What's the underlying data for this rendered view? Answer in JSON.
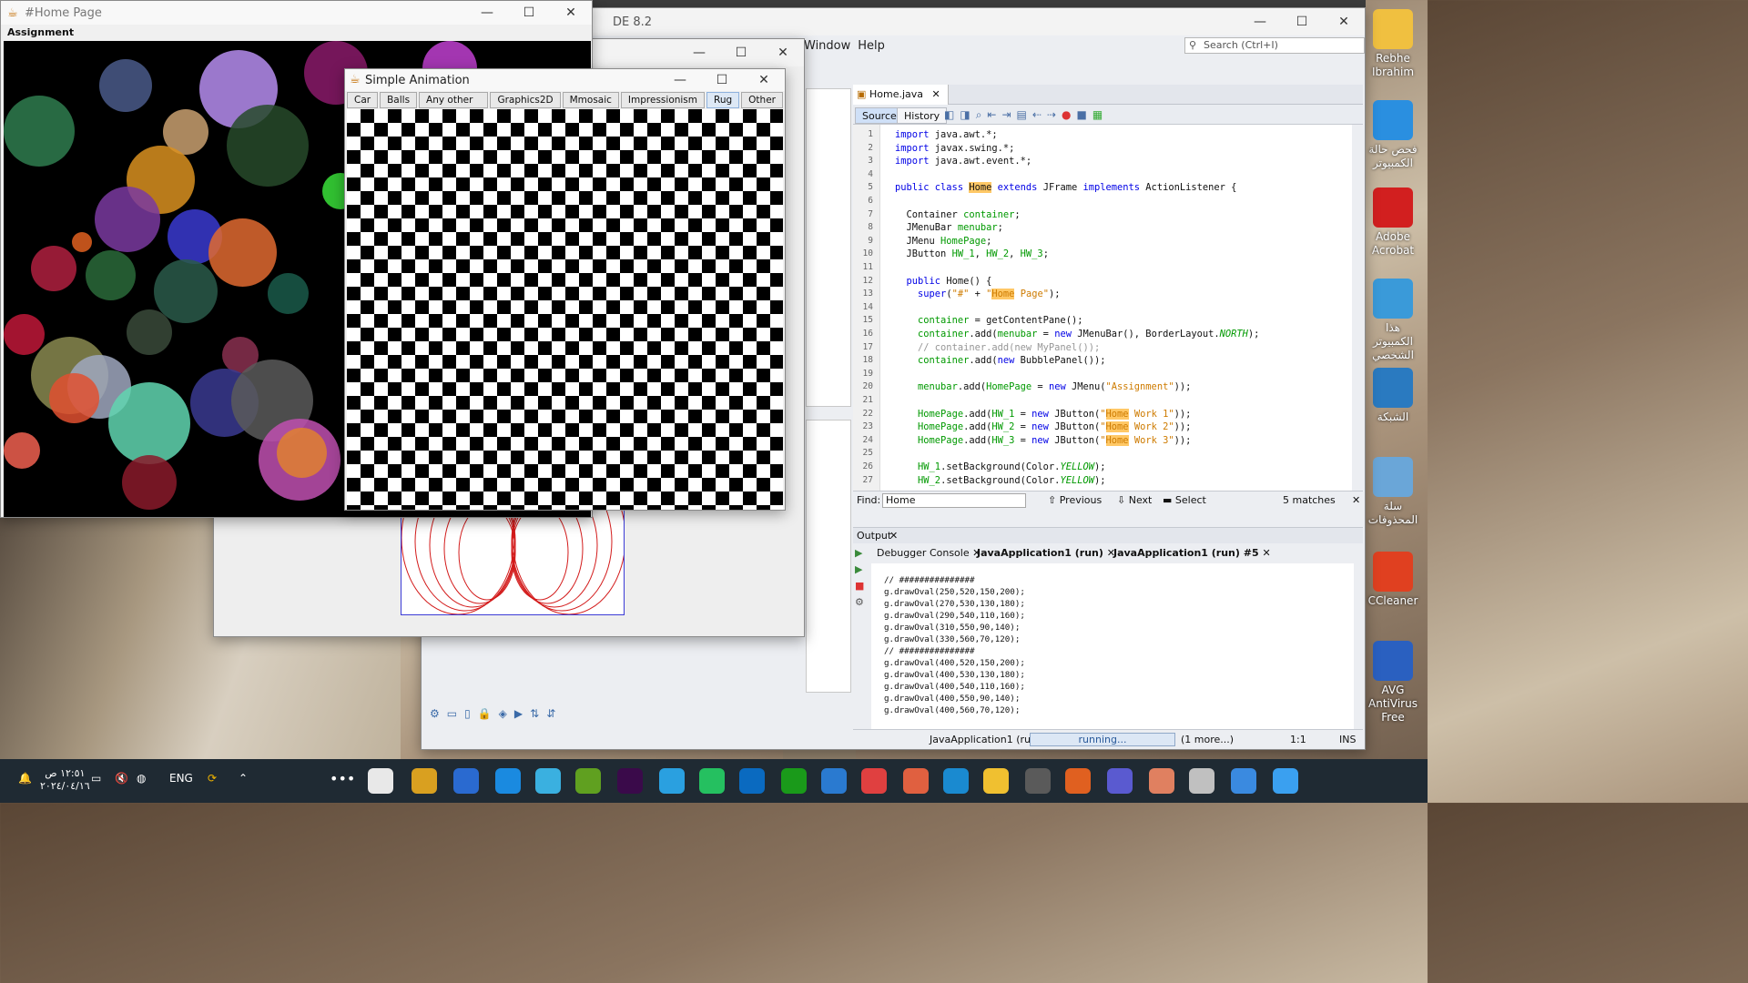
{
  "desktop": {
    "icons": [
      {
        "label": "Rebhe\nIbrahim"
      },
      {
        "label": "فحص حالة\nالكمبيوتر"
      },
      {
        "label": "Adobe\nAcrobat"
      },
      {
        "label": "هذا الكمبيوتر\nالشخصي"
      },
      {
        "label": "الشبكة"
      },
      {
        "label": "سلة\nالمحذوفات"
      },
      {
        "label": "CCleaner"
      },
      {
        "label": "AVG AntiVirus\nFree"
      }
    ]
  },
  "netbeans": {
    "title_fragment": "DE 8.2",
    "menu": [
      "Window",
      "Help"
    ],
    "search_placeholder": "Search (Ctrl+I)",
    "editor_tab": "Home.java",
    "source_tab": "Source",
    "history_tab": "History",
    "code_lines": [
      {
        "n": "1",
        "html": "<span class='kw'>import</span> java.awt.*;"
      },
      {
        "n": "2",
        "html": "<span class='kw'>import</span> javax.swing.*;"
      },
      {
        "n": "3",
        "html": "<span class='kw'>import</span> java.awt.event.*;"
      },
      {
        "n": "4",
        "html": ""
      },
      {
        "n": "5",
        "html": "<span class='kw'>public class</span> <span class='hl'>Home</span> <span class='kw'>extends</span> JFrame <span class='kw'>implements</span> ActionListener {"
      },
      {
        "n": "6",
        "html": ""
      },
      {
        "n": "7",
        "html": "  Container <span class='fld'>container</span>;"
      },
      {
        "n": "8",
        "html": "  JMenuBar <span class='fld'>menubar</span>;"
      },
      {
        "n": "9",
        "html": "  JMenu <span class='fld'>HomePage</span>;"
      },
      {
        "n": "10",
        "html": "  JButton <span class='fld'>HW_1</span>, <span class='fld'>HW_2</span>, <span class='fld'>HW_3</span>;"
      },
      {
        "n": "11",
        "html": ""
      },
      {
        "n": "12",
        "html": "  <span class='kw'>public</span> Home() {"
      },
      {
        "n": "13",
        "html": "    <span class='kw'>super</span>(<span class='str'>\"#\"</span> + <span class='str'>\"<span class='hl'>Home</span> Page\"</span>);"
      },
      {
        "n": "14",
        "html": ""
      },
      {
        "n": "15",
        "html": "    <span class='fld'>container</span> = getContentPane();"
      },
      {
        "n": "16",
        "html": "    <span class='fld'>container</span>.add(<span class='fld'>menubar</span> = <span class='kw'>new</span> JMenuBar(), BorderLayout.<span class='it'>NORTH</span>);"
      },
      {
        "n": "17",
        "html": "    <span class='cm'>// container.add(new MyPanel());</span>"
      },
      {
        "n": "18",
        "html": "    <span class='fld'>container</span>.add(<span class='kw'>new</span> BubblePanel());"
      },
      {
        "n": "19",
        "html": ""
      },
      {
        "n": "20",
        "html": "    <span class='fld'>menubar</span>.add(<span class='fld'>HomePage</span> = <span class='kw'>new</span> JMenu(<span class='str'>\"Assignment\"</span>));"
      },
      {
        "n": "21",
        "html": ""
      },
      {
        "n": "22",
        "html": "    <span class='fld'>HomePage</span>.add(<span class='fld'>HW_1</span> = <span class='kw'>new</span> JButton(<span class='str'>\"<span class='hl'>Home</span> Work 1\"</span>));"
      },
      {
        "n": "23",
        "html": "    <span class='fld'>HomePage</span>.add(<span class='fld'>HW_2</span> = <span class='kw'>new</span> JButton(<span class='str'>\"<span class='hl'>Home</span> Work 2\"</span>));"
      },
      {
        "n": "24",
        "html": "    <span class='fld'>HomePage</span>.add(<span class='fld'>HW_3</span> = <span class='kw'>new</span> JButton(<span class='str'>\"<span class='hl'>Home</span> Work 3\"</span>));"
      },
      {
        "n": "25",
        "html": ""
      },
      {
        "n": "26",
        "html": "    <span class='fld'>HW_1</span>.setBackground(Color.<span class='it'>YELLOW</span>);"
      },
      {
        "n": "27",
        "html": "    <span class='fld'>HW_2</span>.setBackground(Color.<span class='it'>YELLOW</span>);"
      }
    ],
    "find": {
      "label": "Find:",
      "value": "Home",
      "previous": "Previous",
      "next": "Next",
      "select": "Select",
      "matches": "5 matches"
    },
    "output": {
      "title": "Output",
      "tabs": [
        "Debugger Console",
        "JavaApplication1 (run)",
        "JavaApplication1 (run) #5"
      ],
      "lines": [
        "// ###############",
        "g.drawOval(250,520,150,200);",
        "g.drawOval(270,530,130,180);",
        "g.drawOval(290,540,110,160);",
        "g.drawOval(310,550,90,140);",
        "g.drawOval(330,560,70,120);",
        "// ###############",
        "g.drawOval(400,520,150,200);",
        "g.drawOval(400,530,130,180);",
        "g.drawOval(400,540,110,160);",
        "g.drawOval(400,550,90,140);",
        "g.drawOval(400,560,70,120);"
      ]
    },
    "status": {
      "app": "JavaApplication1 (run)",
      "running": "running...",
      "more": "(1 more...)",
      "position": "1:1",
      "mode": "INS"
    }
  },
  "home_window": {
    "title": "#Home Page",
    "menu": "Assignment"
  },
  "anim_window": {
    "title": "Simple Animation",
    "tabs": [
      "Car",
      "Balls",
      "Any other Shape",
      "Graphics2D",
      "Mmosaic",
      "Impressionism",
      "Rug",
      "Other"
    ],
    "active_tab": "Rug"
  },
  "taskbar": {
    "time": "١٢:٥١ ص",
    "date": "٢٠٢٤/٠٤/١٦",
    "lang": "ENG"
  }
}
